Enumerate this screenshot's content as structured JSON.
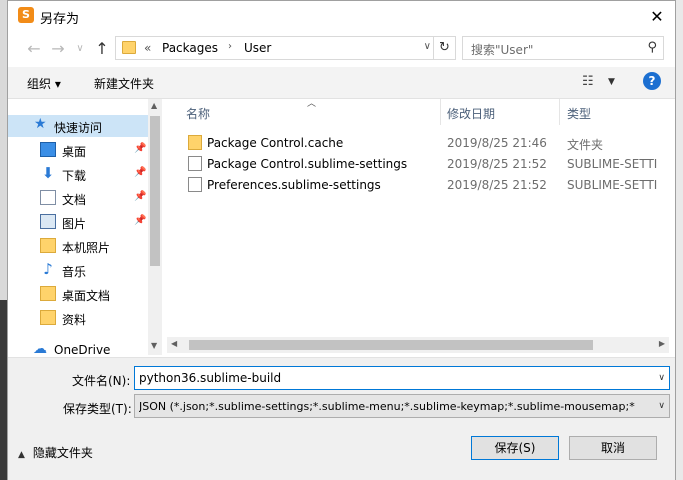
{
  "window": {
    "title": "另存为",
    "app_icon_label": "S",
    "close": "✕"
  },
  "address_bar": {
    "overflow": "«",
    "segments": [
      "Packages",
      "User"
    ],
    "search_placeholder": "搜索\"User\""
  },
  "toolbar": {
    "organize": "组织 ▾",
    "new_folder": "新建文件夹"
  },
  "nav_pane": {
    "quick_access": "快速访问",
    "items": [
      {
        "label": "桌面",
        "icon": "desktop-icon",
        "pinned": true
      },
      {
        "label": "下载",
        "icon": "download-icon",
        "pinned": true
      },
      {
        "label": "文档",
        "icon": "document-icon",
        "pinned": true
      },
      {
        "label": "图片",
        "icon": "picture-icon",
        "pinned": true
      },
      {
        "label": "本机照片",
        "icon": "folder-icon",
        "pinned": false
      },
      {
        "label": "音乐",
        "icon": "music-icon",
        "pinned": false
      },
      {
        "label": "桌面文档",
        "icon": "folder-icon",
        "pinned": false
      },
      {
        "label": "资料",
        "icon": "folder-icon",
        "pinned": false
      }
    ],
    "onedrive": "OneDrive"
  },
  "file_list": {
    "columns": {
      "name": "名称",
      "modified": "修改日期",
      "type": "类型"
    },
    "rows": [
      {
        "name": "Package Control.cache",
        "date": "2019/8/25 21:46",
        "type": "文件夹",
        "kind": "folder"
      },
      {
        "name": "Package Control.sublime-settings",
        "date": "2019/8/25 21:52",
        "type": "SUBLIME-SETTI",
        "kind": "file"
      },
      {
        "name": "Preferences.sublime-settings",
        "date": "2019/8/25 21:52",
        "type": "SUBLIME-SETTI",
        "kind": "file"
      }
    ]
  },
  "form": {
    "filename_label": "文件名(N):",
    "filename_value": "python36.sublime-build",
    "savetype_label": "保存类型(T):",
    "savetype_value": "JSON (*.json;*.sublime-settings;*.sublime-menu;*.sublime-keymap;*.sublime-mousemap;*"
  },
  "footer": {
    "hide_folders": "隐藏文件夹",
    "save": "保存(S)",
    "cancel": "取消"
  },
  "colors": {
    "accent": "#0078d7",
    "selected_nav": "#cce4f7",
    "folder": "#ffd36b"
  }
}
